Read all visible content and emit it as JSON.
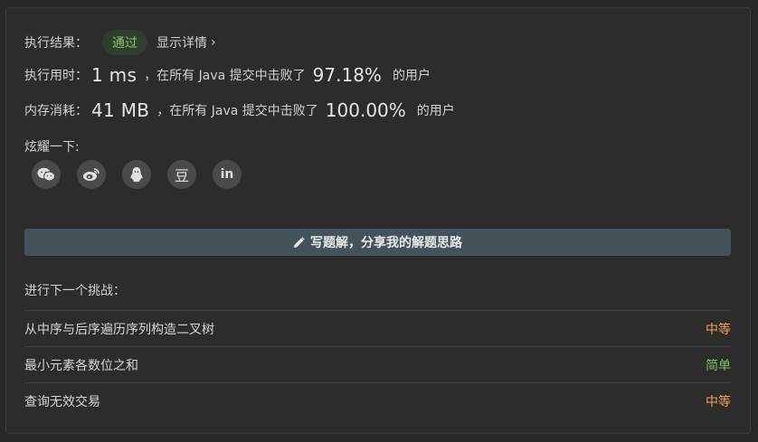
{
  "result": {
    "label": "执行结果：",
    "status": "通过",
    "details": "显示详情",
    "details_chevron": "›"
  },
  "runtime": {
    "label": "执行用时：",
    "value": "1 ms",
    "middle": "，在所有 Java 提交中击败了",
    "percent": "97.18%",
    "suffix": "的用户"
  },
  "memory": {
    "label": "内存消耗：",
    "value": "41 MB",
    "middle": "，在所有 Java 提交中击败了",
    "percent": "100.00%",
    "suffix": "的用户"
  },
  "share": {
    "label": "炫耀一下:",
    "icons": [
      "wechat-icon",
      "weibo-icon",
      "qq-icon",
      "douban-icon",
      "linkedin-icon"
    ],
    "douban_glyph": "豆",
    "linkedin_glyph": "in"
  },
  "solution_button": {
    "label": "写题解，分享我的解题思路",
    "icon": "pencil-icon"
  },
  "next": {
    "label": "进行下一个挑战：",
    "problems": [
      {
        "title": "从中序与后序遍历序列构造二叉树",
        "difficulty": "中等"
      },
      {
        "title": "最小元素各数位之和",
        "difficulty": "简单"
      },
      {
        "title": "查询无效交易",
        "difficulty": "中等"
      }
    ]
  },
  "colors": {
    "pass": "#8cc56f",
    "medium": "#f0a15a",
    "easy": "#7bbf6a",
    "button": "#44535a"
  }
}
